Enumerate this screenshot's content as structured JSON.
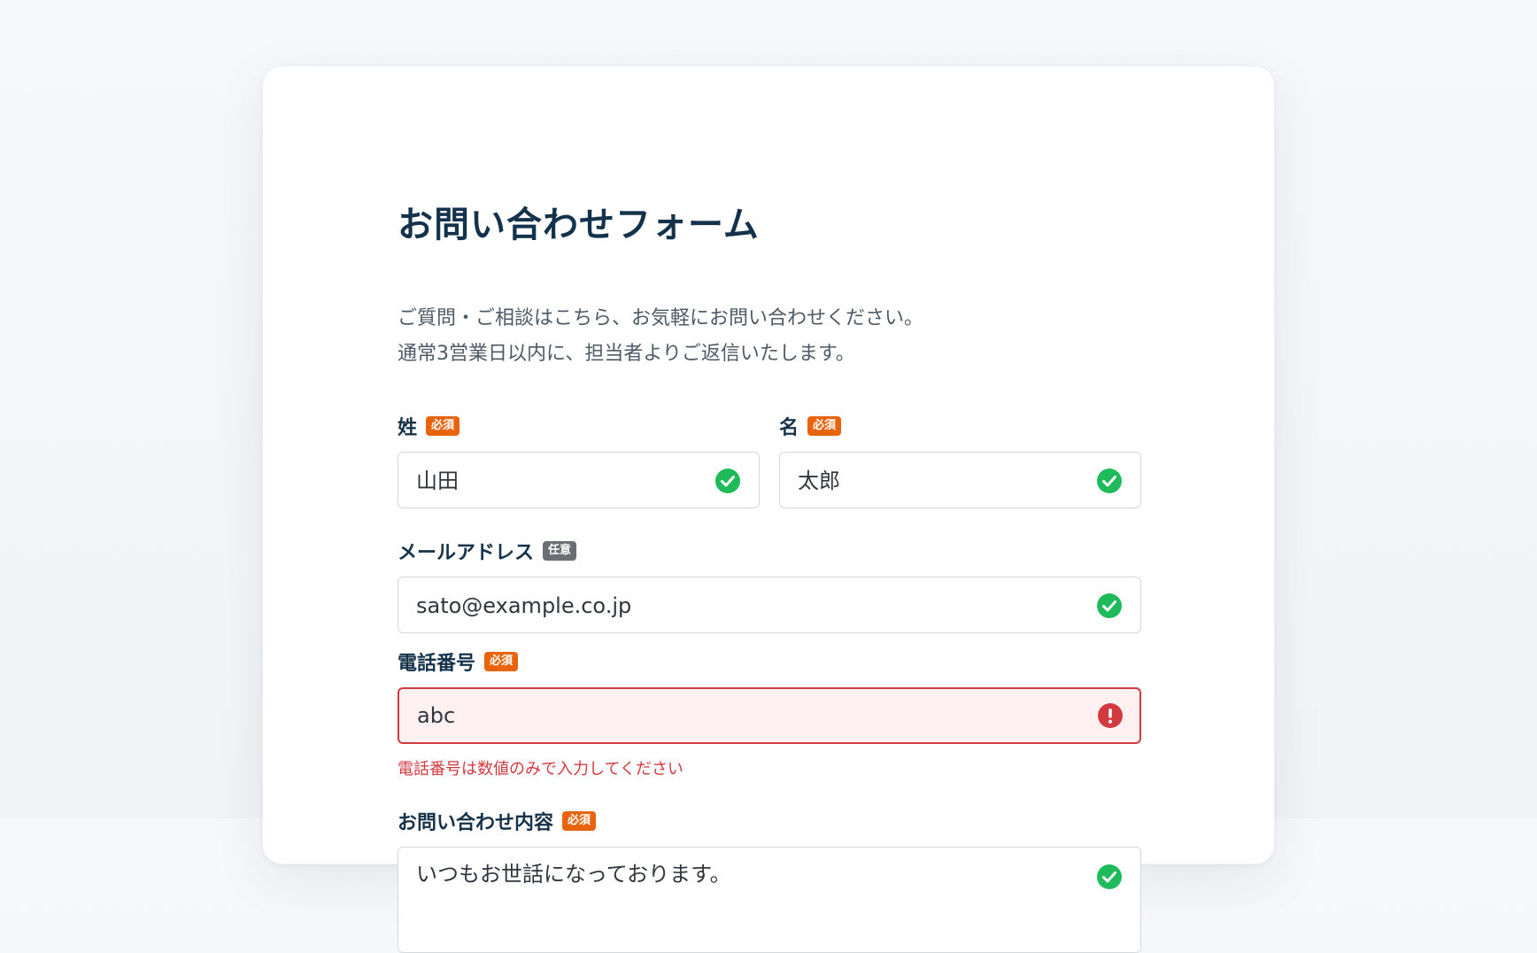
{
  "form": {
    "title": "お問い合わせフォーム",
    "description": [
      "ご質問・ご相談はこちら、お気軽にお問い合わせください。",
      "通常3営業日以内に、担当者よりご返信いたします。"
    ],
    "fields": {
      "last_name": {
        "label": "姓",
        "badge": "必須",
        "value": "山田",
        "status": "valid"
      },
      "first_name": {
        "label": "名",
        "badge": "必須",
        "value": "太郎",
        "status": "valid"
      },
      "email": {
        "label": "メールアドレス",
        "badge": "任意",
        "value": "sato@example.co.jp",
        "status": "valid"
      },
      "phone": {
        "label": "電話番号",
        "badge": "必須",
        "value": "abc",
        "status": "error",
        "error_message": "電話番号は数値のみで入力してください"
      },
      "inquiry": {
        "label": "お問い合わせ内容",
        "badge": "必須",
        "value": "いつもお世話になっております。",
        "status": "valid"
      }
    }
  },
  "colors": {
    "required_badge": "#e8640c",
    "optional_badge": "#6b6f74",
    "valid_icon": "#1fba5a",
    "error": "#d33a3f",
    "error_field_bg": "#fff1f1",
    "title": "#14324b"
  },
  "icons": {
    "valid": "check-circle-icon",
    "error": "exclamation-circle-icon"
  }
}
